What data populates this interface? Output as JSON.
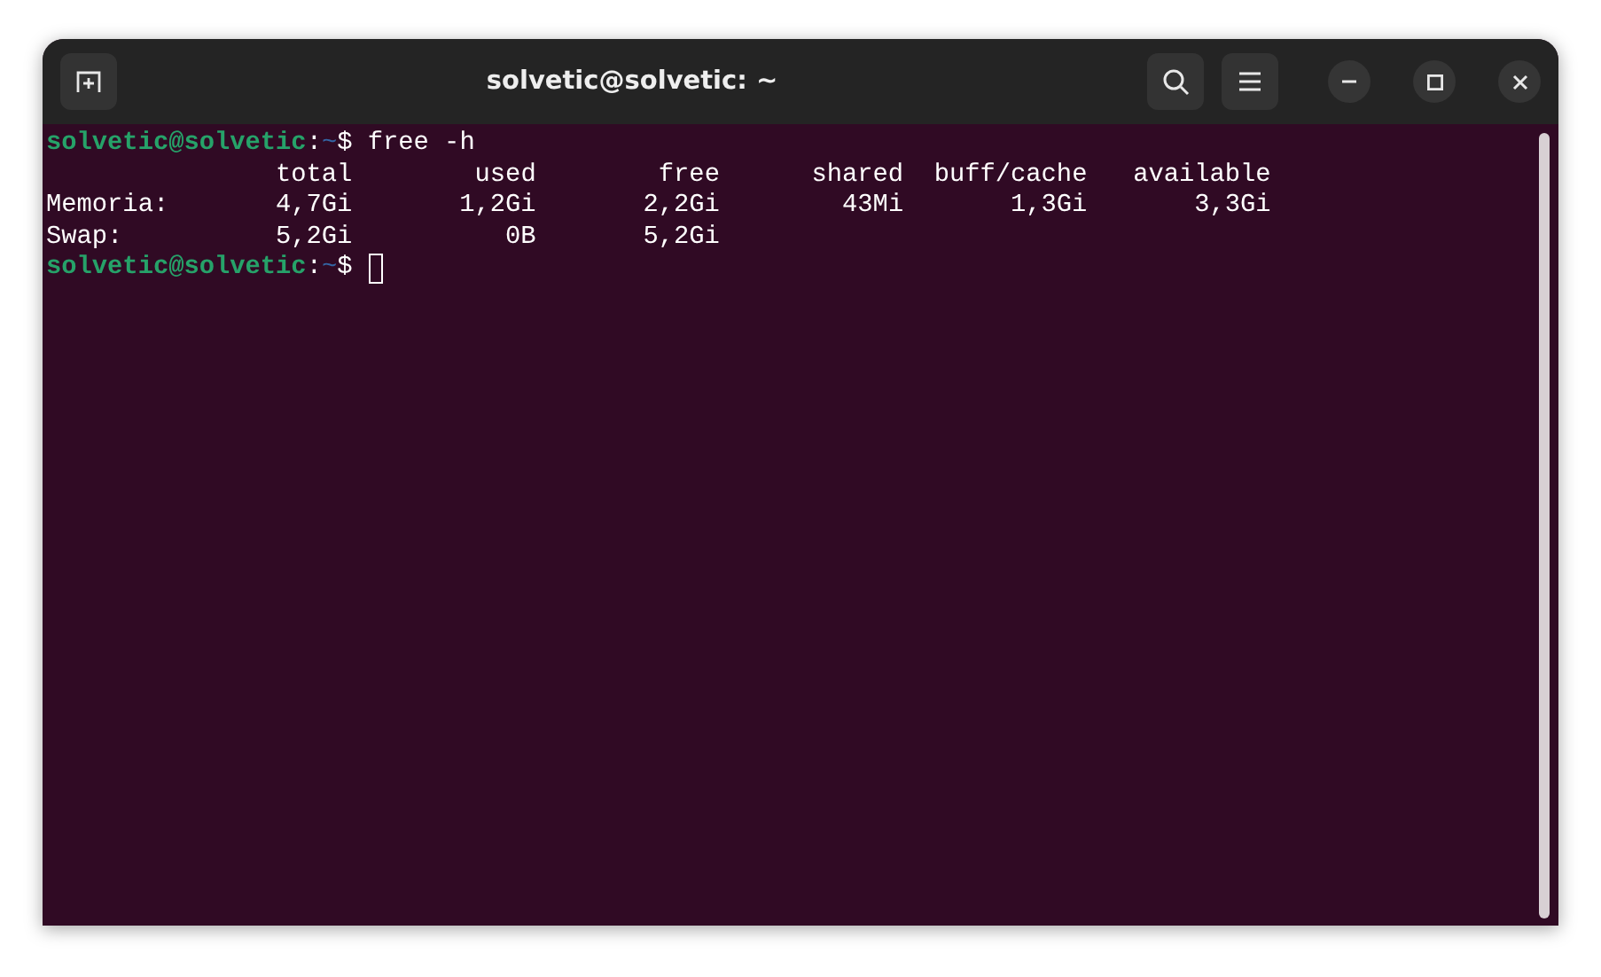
{
  "window": {
    "title": "solvetic@solvetic: ~"
  },
  "lines": [
    {
      "kind": "prompt",
      "user": "solvetic@solvetic",
      "separator": ":",
      "path": "~",
      "symbol": "$",
      "command": "free -h",
      "cursor": false
    },
    {
      "kind": "row",
      "cells": [
        "total",
        "used",
        "free",
        "shared",
        "buff/cache",
        "available"
      ]
    },
    {
      "kind": "row",
      "label": "Memoria:",
      "cells": [
        "4,7Gi",
        "1,2Gi",
        "2,2Gi",
        "43Mi",
        "1,3Gi",
        "3,3Gi"
      ]
    },
    {
      "kind": "row",
      "label": "Swap:",
      "cells": [
        "5,2Gi",
        "0B",
        "5,2Gi"
      ]
    },
    {
      "kind": "prompt",
      "user": "solvetic@solvetic",
      "separator": ":",
      "path": "~",
      "symbol": "$",
      "cursor": true
    }
  ]
}
